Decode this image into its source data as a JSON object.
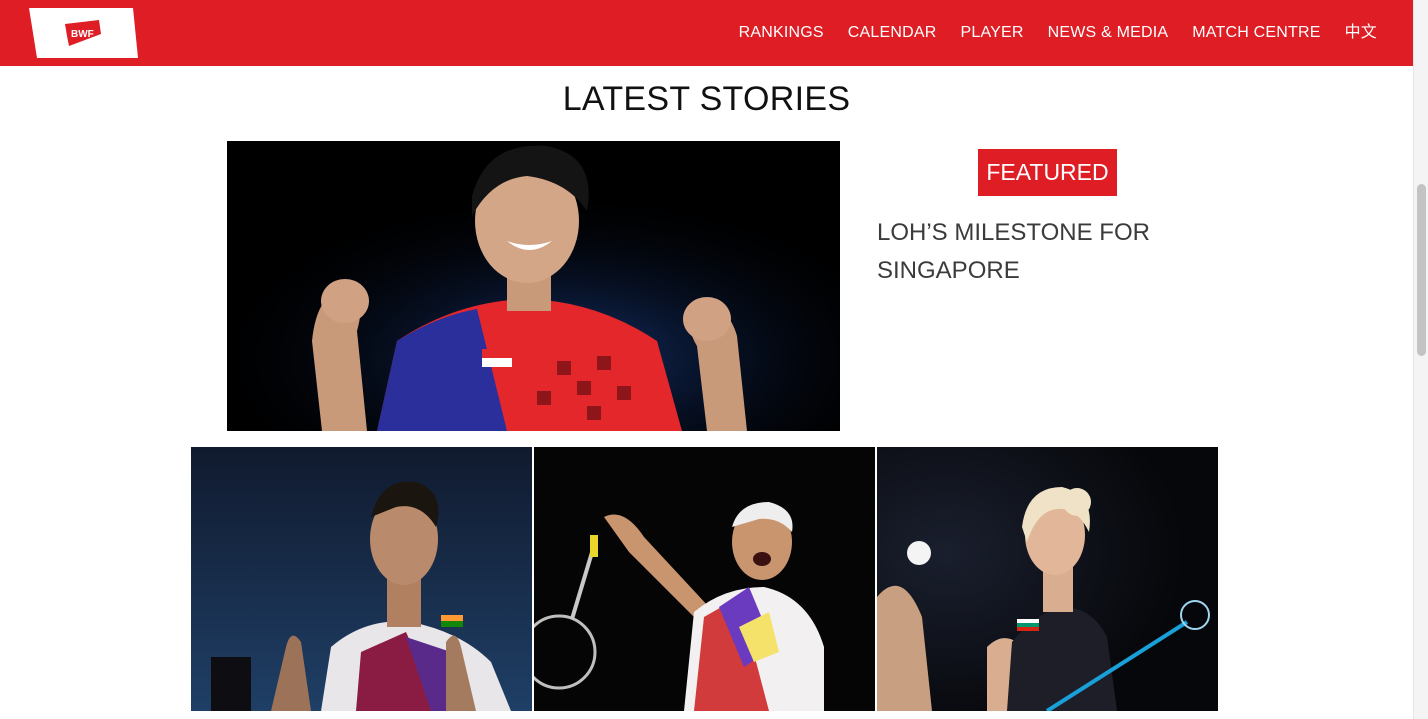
{
  "header": {
    "logo_text": "BWF",
    "brand_color": "#de1d25",
    "nav": [
      {
        "label": "RANKINGS"
      },
      {
        "label": "CALENDAR"
      },
      {
        "label": "PLAYER"
      },
      {
        "label": "NEWS & MEDIA"
      },
      {
        "label": "MATCH CENTRE"
      },
      {
        "label": "中文"
      }
    ]
  },
  "main": {
    "section_title": "LATEST STORIES",
    "featured": {
      "badge": "FEATURED",
      "headline": "LOH’S MILESTONE FOR SINGAPORE",
      "image_icon": "photo-celebrating-player-singapore"
    },
    "stories": [
      {
        "image_icon": "photo-player-india-jersey"
      },
      {
        "image_icon": "photo-player-smash-red-jersey"
      },
      {
        "image_icon": "photo-player-bulgaria-serve"
      }
    ]
  }
}
